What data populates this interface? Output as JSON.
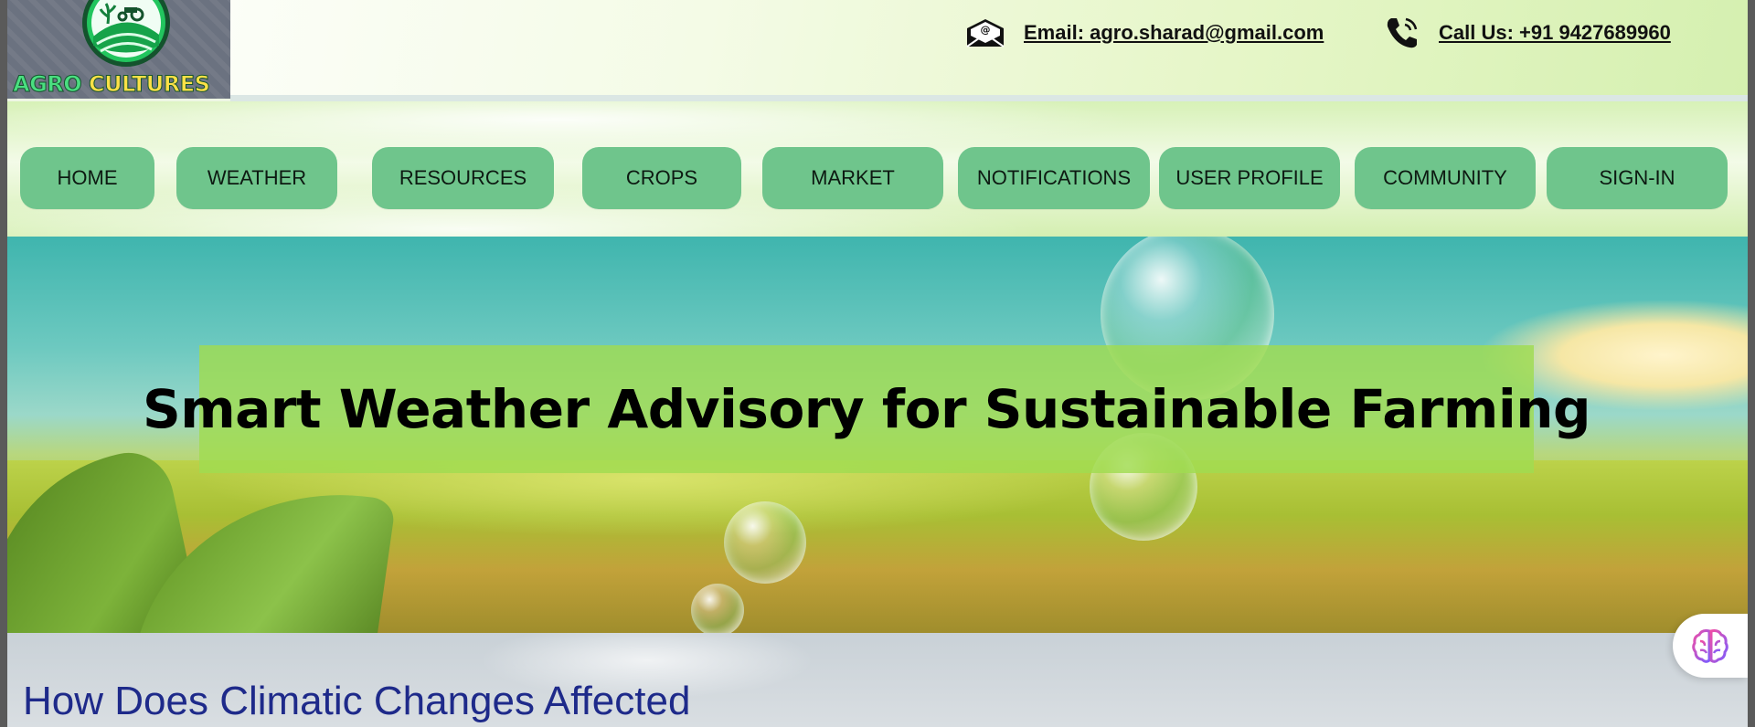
{
  "brand": {
    "logo_text_part1": "AGRO",
    "logo_text_part2": "CULTURES",
    "colors": {
      "part1": "#4ade80",
      "part2": "#fde047"
    }
  },
  "contact": {
    "email_icon": "email-envelope-icon",
    "email_label": "Email: agro.sharad@gmail.com",
    "phone_icon": "phone-icon",
    "phone_label": "Call Us: +91 9427689960"
  },
  "nav": {
    "items": [
      {
        "label": "HOME"
      },
      {
        "label": "WEATHER"
      },
      {
        "label": "RESOURCES"
      },
      {
        "label": "CROPS"
      },
      {
        "label": "MARKET"
      },
      {
        "label": "NOTIFICATIONS"
      },
      {
        "label": "USER PROFILE"
      },
      {
        "label": "COMMUNITY"
      },
      {
        "label": "SIGN-IN"
      }
    ],
    "button_color": "#6fc58c"
  },
  "hero": {
    "title": "Smart Weather Advisory for Sustainable Farming"
  },
  "section": {
    "heading": "How Does Climatic Changes Affected"
  },
  "widget": {
    "icon": "brain-icon"
  }
}
